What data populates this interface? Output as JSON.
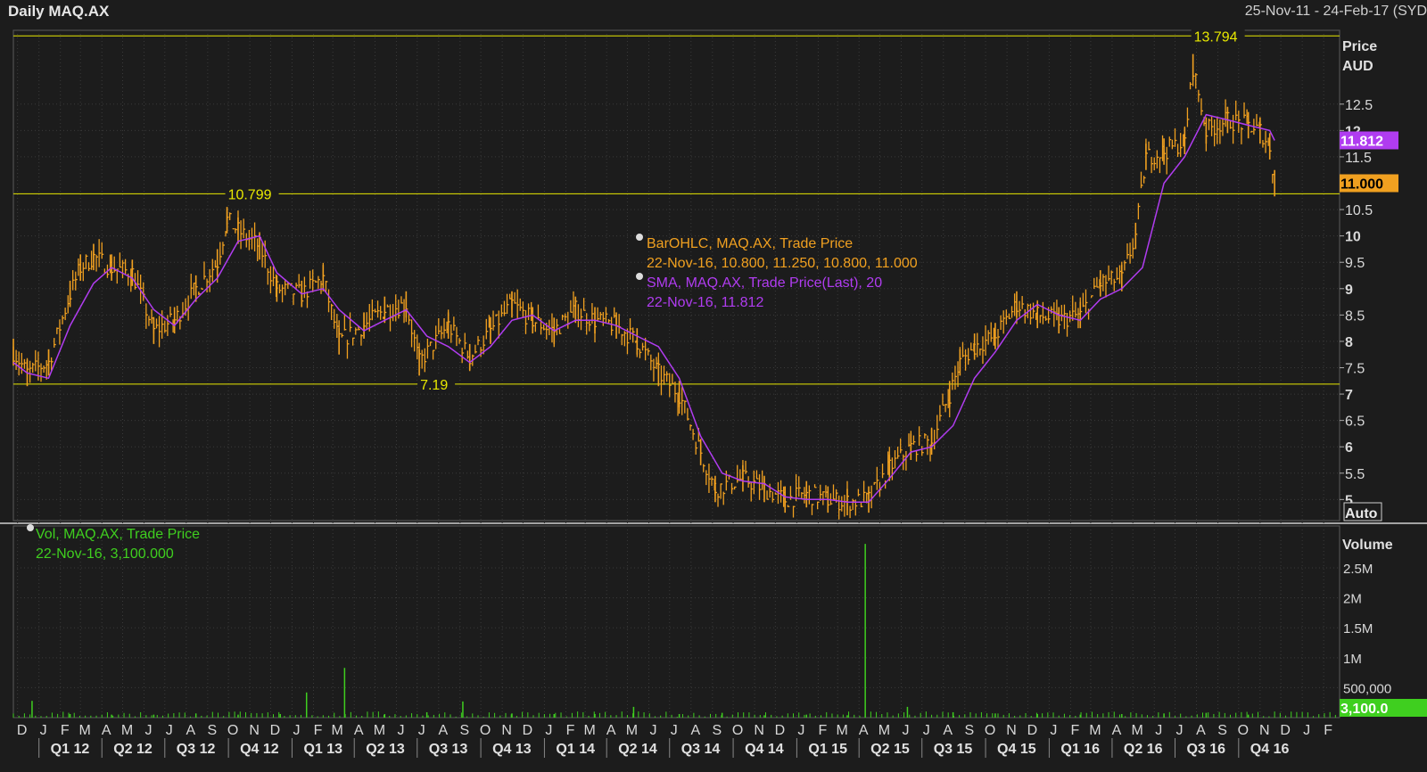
{
  "header": {
    "title": "Daily MAQ.AX",
    "date_range": "25-Nov-11 - 24-Feb-17 (SYD"
  },
  "colors": {
    "price_bars": "#f0a020",
    "sma": "#b03cf0",
    "volume": "#3fcf1f",
    "reference_lines": "#e8e800",
    "grid": "#3a3a3a",
    "background": "#1c1c1c"
  },
  "chart_data": [
    {
      "type": "line",
      "name": "price_panel",
      "y_axis_title": "Price",
      "y_axis_unit": "AUD",
      "y_ticks": [
        "5",
        "5.5",
        "6",
        "6.5",
        "7",
        "7.5",
        "8",
        "8.5",
        "9",
        "9.5",
        "10",
        "10.5",
        "11.5",
        "12",
        "12.5"
      ],
      "ylim": [
        4.6,
        13.9
      ],
      "y_scale_mode": "Auto",
      "grid": true,
      "current_tags": [
        {
          "label": "11.812",
          "value": 11.812,
          "series": "SMA"
        },
        {
          "label": "11.000",
          "value": 11.0,
          "series": "BarOHLC"
        }
      ],
      "reference_lines": [
        {
          "label": "13.794",
          "value": 13.794,
          "label_date": "2016-07-27"
        },
        {
          "label": "10.799",
          "value": 10.799,
          "label_date": "2012-09-29"
        },
        {
          "label": "7.19",
          "value": 7.19,
          "label_date": "2013-07-04"
        }
      ],
      "legend": [
        {
          "text": "BarOHLC, MAQ.AX, Trade Price",
          "values": "22-Nov-16, 10.800, 11.250, 10.800, 11.000",
          "color": "#f0a020"
        },
        {
          "text": "SMA, MAQ.AX, Trade Price(Last),  20",
          "values": "22-Nov-16, 11.812",
          "color": "#b03cf0"
        }
      ],
      "series": [
        {
          "name": "BarOHLC, MAQ.AX, Trade Price",
          "style": "ohlc",
          "x": [
            "2011-11-25",
            "2011-12-15",
            "2012-01-15",
            "2012-02-15",
            "2012-03-01",
            "2012-03-20",
            "2012-04-15",
            "2012-05-15",
            "2012-06-15",
            "2012-07-15",
            "2012-08-15",
            "2012-09-15",
            "2012-09-29",
            "2012-10-15",
            "2012-11-15",
            "2012-12-10",
            "2013-01-15",
            "2013-02-15",
            "2013-03-10",
            "2013-04-15",
            "2013-05-15",
            "2013-06-15",
            "2013-07-04",
            "2013-08-15",
            "2013-09-15",
            "2013-10-15",
            "2013-11-15",
            "2013-12-15",
            "2014-01-15",
            "2014-02-15",
            "2014-03-15",
            "2014-04-15",
            "2014-05-15",
            "2014-06-15",
            "2014-07-15",
            "2014-08-15",
            "2014-09-05",
            "2014-10-15",
            "2014-11-15",
            "2014-12-15",
            "2015-01-15",
            "2015-02-15",
            "2015-03-15",
            "2015-04-15",
            "2015-05-15",
            "2015-06-15",
            "2015-07-15",
            "2015-08-10",
            "2015-08-25",
            "2015-09-15",
            "2015-10-15",
            "2015-11-15",
            "2015-12-15",
            "2016-01-15",
            "2016-02-15",
            "2016-03-15",
            "2016-04-15",
            "2016-05-05",
            "2016-05-20",
            "2016-06-15",
            "2016-07-15",
            "2016-07-27",
            "2016-08-15",
            "2016-09-15",
            "2016-10-15",
            "2016-11-01",
            "2016-11-15",
            "2016-11-22"
          ],
          "values": [
            7.8,
            7.4,
            7.6,
            8.9,
            9.4,
            9.6,
            9.4,
            9.3,
            8.2,
            8.4,
            9.0,
            9.5,
            10.3,
            10.1,
            9.8,
            9.0,
            8.9,
            9.2,
            8.0,
            8.3,
            8.6,
            8.7,
            7.6,
            8.3,
            7.7,
            8.2,
            8.7,
            8.4,
            8.2,
            8.6,
            8.4,
            8.3,
            8.0,
            7.4,
            7.0,
            5.9,
            5.2,
            5.4,
            5.2,
            5.0,
            5.1,
            5.0,
            4.95,
            5.0,
            5.6,
            6.0,
            6.1,
            7.0,
            7.6,
            7.9,
            8.1,
            8.7,
            8.5,
            8.4,
            8.5,
            9.1,
            9.2,
            10.0,
            11.5,
            11.6,
            11.8,
            13.2,
            12.0,
            12.2,
            12.1,
            12.0,
            11.7,
            11.0
          ],
          "color": "#f0a020"
        },
        {
          "name": "SMA, MAQ.AX, Trade Price(Last),  20",
          "style": "line",
          "x": [
            "2011-11-25",
            "2011-12-15",
            "2012-01-15",
            "2012-02-15",
            "2012-03-20",
            "2012-04-15",
            "2012-05-15",
            "2012-06-15",
            "2012-07-15",
            "2012-08-15",
            "2012-09-15",
            "2012-10-15",
            "2012-11-15",
            "2012-12-10",
            "2013-01-15",
            "2013-02-15",
            "2013-03-10",
            "2013-04-15",
            "2013-05-15",
            "2013-06-15",
            "2013-07-15",
            "2013-08-15",
            "2013-09-15",
            "2013-10-15",
            "2013-11-15",
            "2013-12-15",
            "2014-01-15",
            "2014-02-15",
            "2014-03-15",
            "2014-04-15",
            "2014-05-15",
            "2014-06-15",
            "2014-07-15",
            "2014-08-15",
            "2014-09-15",
            "2014-10-15",
            "2014-11-15",
            "2014-12-15",
            "2015-01-15",
            "2015-02-15",
            "2015-03-15",
            "2015-04-15",
            "2015-05-15",
            "2015-06-15",
            "2015-07-15",
            "2015-08-15",
            "2015-09-15",
            "2015-10-15",
            "2015-11-15",
            "2015-12-15",
            "2016-01-15",
            "2016-02-15",
            "2016-03-15",
            "2016-04-15",
            "2016-05-15",
            "2016-06-15",
            "2016-07-15",
            "2016-08-15",
            "2016-09-15",
            "2016-10-15",
            "2016-11-15",
            "2016-11-22"
          ],
          "values": [
            7.6,
            7.4,
            7.3,
            8.3,
            9.1,
            9.4,
            9.2,
            8.6,
            8.3,
            8.8,
            9.2,
            9.9,
            10.0,
            9.3,
            8.9,
            9.0,
            8.6,
            8.2,
            8.4,
            8.6,
            8.1,
            7.9,
            7.6,
            7.9,
            8.4,
            8.5,
            8.2,
            8.4,
            8.4,
            8.3,
            8.1,
            7.9,
            7.3,
            6.2,
            5.5,
            5.35,
            5.3,
            5.05,
            5.0,
            5.0,
            4.95,
            4.95,
            5.4,
            5.9,
            6.0,
            6.4,
            7.3,
            7.8,
            8.4,
            8.7,
            8.5,
            8.4,
            8.8,
            9.0,
            9.4,
            11.0,
            11.5,
            12.3,
            12.2,
            12.1,
            12.0,
            11.812
          ],
          "color": "#b03cf0"
        }
      ]
    },
    {
      "type": "bar",
      "name": "volume_panel",
      "y_axis_title": "Volume",
      "y_ticks": [
        "500,000",
        "1M",
        "1.5M",
        "2M",
        "2.5M"
      ],
      "ylim": [
        0,
        3200000
      ],
      "current_tag": {
        "label": "3,100.0",
        "value": 3100
      },
      "legend": {
        "text": "Vol, MAQ.AX, Trade Price",
        "values": "22-Nov-16, 3,100.000",
        "color": "#3fcf1f"
      },
      "series": [
        {
          "name": "Vol, MAQ.AX, Trade Price",
          "x": [
            "2011-12-22",
            "2012-02-15",
            "2012-04-15",
            "2012-06-15",
            "2012-08-15",
            "2012-10-15",
            "2012-12-15",
            "2013-01-22",
            "2013-03-18",
            "2013-05-15",
            "2013-07-15",
            "2013-09-05",
            "2013-11-15",
            "2014-01-15",
            "2014-03-15",
            "2014-05-10",
            "2014-07-15",
            "2014-09-15",
            "2014-11-15",
            "2015-01-15",
            "2015-03-15",
            "2015-04-10",
            "2015-06-10",
            "2015-08-15",
            "2015-10-15",
            "2015-12-15",
            "2016-02-15",
            "2016-04-15",
            "2016-06-15",
            "2016-08-15",
            "2016-10-15",
            "2016-11-22"
          ],
          "values": [
            280000,
            60000,
            50000,
            50000,
            70000,
            50000,
            60000,
            420000,
            830000,
            60000,
            90000,
            270000,
            70000,
            60000,
            60000,
            180000,
            60000,
            80000,
            40000,
            50000,
            40000,
            2900000,
            180000,
            90000,
            70000,
            60000,
            50000,
            60000,
            70000,
            80000,
            50000,
            3100
          ],
          "color": "#3fcf1f"
        }
      ]
    }
  ],
  "x_axis": {
    "month_ticks": [
      {
        "label": "D",
        "date": "2011-12-01"
      },
      {
        "label": "J",
        "date": "2012-01-01"
      },
      {
        "label": "F",
        "date": "2012-02-01"
      },
      {
        "label": "M",
        "date": "2012-03-01"
      },
      {
        "label": "A",
        "date": "2012-04-01"
      },
      {
        "label": "M",
        "date": "2012-05-01"
      },
      {
        "label": "J",
        "date": "2012-06-01"
      },
      {
        "label": "J",
        "date": "2012-07-01"
      },
      {
        "label": "A",
        "date": "2012-08-01"
      },
      {
        "label": "S",
        "date": "2012-09-01"
      },
      {
        "label": "O",
        "date": "2012-10-01"
      },
      {
        "label": "N",
        "date": "2012-11-01"
      },
      {
        "label": "D",
        "date": "2012-12-01"
      },
      {
        "label": "J",
        "date": "2013-01-01"
      },
      {
        "label": "F",
        "date": "2013-02-01"
      },
      {
        "label": "M",
        "date": "2013-03-01"
      },
      {
        "label": "A",
        "date": "2013-04-01"
      },
      {
        "label": "M",
        "date": "2013-05-01"
      },
      {
        "label": "J",
        "date": "2013-06-01"
      },
      {
        "label": "J",
        "date": "2013-07-01"
      },
      {
        "label": "A",
        "date": "2013-08-01"
      },
      {
        "label": "S",
        "date": "2013-09-01"
      },
      {
        "label": "O",
        "date": "2013-10-01"
      },
      {
        "label": "N",
        "date": "2013-11-01"
      },
      {
        "label": "D",
        "date": "2013-12-01"
      },
      {
        "label": "J",
        "date": "2014-01-01"
      },
      {
        "label": "F",
        "date": "2014-02-01"
      },
      {
        "label": "M",
        "date": "2014-03-01"
      },
      {
        "label": "A",
        "date": "2014-04-01"
      },
      {
        "label": "M",
        "date": "2014-05-01"
      },
      {
        "label": "J",
        "date": "2014-06-01"
      },
      {
        "label": "J",
        "date": "2014-07-01"
      },
      {
        "label": "A",
        "date": "2014-08-01"
      },
      {
        "label": "S",
        "date": "2014-09-01"
      },
      {
        "label": "O",
        "date": "2014-10-01"
      },
      {
        "label": "N",
        "date": "2014-11-01"
      },
      {
        "label": "D",
        "date": "2014-12-01"
      },
      {
        "label": "J",
        "date": "2015-01-01"
      },
      {
        "label": "F",
        "date": "2015-02-01"
      },
      {
        "label": "M",
        "date": "2015-03-01"
      },
      {
        "label": "A",
        "date": "2015-04-01"
      },
      {
        "label": "M",
        "date": "2015-05-01"
      },
      {
        "label": "J",
        "date": "2015-06-01"
      },
      {
        "label": "J",
        "date": "2015-07-01"
      },
      {
        "label": "A",
        "date": "2015-08-01"
      },
      {
        "label": "S",
        "date": "2015-09-01"
      },
      {
        "label": "O",
        "date": "2015-10-01"
      },
      {
        "label": "N",
        "date": "2015-11-01"
      },
      {
        "label": "D",
        "date": "2015-12-01"
      },
      {
        "label": "J",
        "date": "2016-01-01"
      },
      {
        "label": "F",
        "date": "2016-02-01"
      },
      {
        "label": "M",
        "date": "2016-03-01"
      },
      {
        "label": "A",
        "date": "2016-04-01"
      },
      {
        "label": "M",
        "date": "2016-05-01"
      },
      {
        "label": "J",
        "date": "2016-06-01"
      },
      {
        "label": "J",
        "date": "2016-07-01"
      },
      {
        "label": "A",
        "date": "2016-08-01"
      },
      {
        "label": "S",
        "date": "2016-09-01"
      },
      {
        "label": "O",
        "date": "2016-10-01"
      },
      {
        "label": "N",
        "date": "2016-11-01"
      },
      {
        "label": "D",
        "date": "2016-12-01"
      },
      {
        "label": "J",
        "date": "2017-01-01"
      },
      {
        "label": "F",
        "date": "2017-02-01"
      }
    ],
    "quarter_labels": [
      {
        "label": "Q1 12",
        "date": "2012-01-01"
      },
      {
        "label": "Q2 12",
        "date": "2012-04-01"
      },
      {
        "label": "Q3 12",
        "date": "2012-07-01"
      },
      {
        "label": "Q4 12",
        "date": "2012-10-01"
      },
      {
        "label": "Q1 13",
        "date": "2013-01-01"
      },
      {
        "label": "Q2 13",
        "date": "2013-04-01"
      },
      {
        "label": "Q3 13",
        "date": "2013-07-01"
      },
      {
        "label": "Q4 13",
        "date": "2013-10-01"
      },
      {
        "label": "Q1 14",
        "date": "2014-01-01"
      },
      {
        "label": "Q2 14",
        "date": "2014-04-01"
      },
      {
        "label": "Q3 14",
        "date": "2014-07-01"
      },
      {
        "label": "Q4 14",
        "date": "2014-10-01"
      },
      {
        "label": "Q1 15",
        "date": "2015-01-01"
      },
      {
        "label": "Q2 15",
        "date": "2015-04-01"
      },
      {
        "label": "Q3 15",
        "date": "2015-07-01"
      },
      {
        "label": "Q4 15",
        "date": "2015-10-01"
      },
      {
        "label": "Q1 16",
        "date": "2016-01-01"
      },
      {
        "label": "Q2 16",
        "date": "2016-04-01"
      },
      {
        "label": "Q3 16",
        "date": "2016-07-01"
      },
      {
        "label": "Q4 16",
        "date": "2016-10-01"
      }
    ],
    "xlim": [
      "2011-11-25",
      "2017-02-24"
    ]
  }
}
